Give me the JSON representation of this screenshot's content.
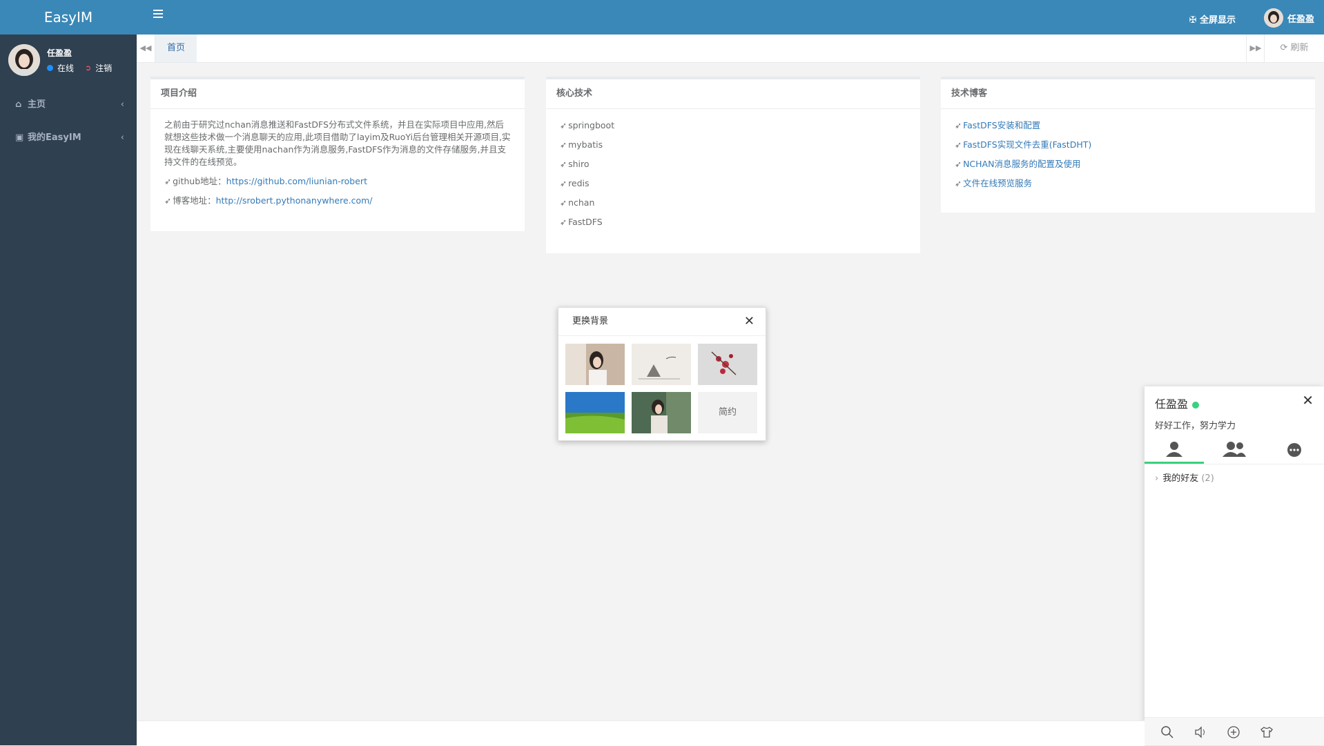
{
  "app": {
    "brand": "EasyIM"
  },
  "profile": {
    "name": "任盈盈",
    "status": "在线",
    "logout": "注销"
  },
  "sidebar": {
    "items": [
      {
        "label": "主页"
      },
      {
        "label": "我的EasyIM"
      }
    ]
  },
  "topbar": {
    "fullscreen": "全屏显示",
    "username": "任盈盈"
  },
  "tabs": {
    "home": "首页",
    "refresh": "刷新"
  },
  "intro": {
    "title": "项目介绍",
    "text": "之前由于研究过nchan消息推送和FastDFS分布式文件系统，并且在实际项目中应用,然后就想这些技术做一个消息聊天的应用,此项目借助了layim及RuoYi后台管理相关开源项目,实现在线聊天系统,主要使用nachan作为消息服务,FastDFS作为消息的文件存储服务,并且支持文件的在线预览。",
    "github_label": "github地址：",
    "github_url": "https://github.com/liunian-robert",
    "blog_label": "博客地址：",
    "blog_url": "http://srobert.pythonanywhere.com/"
  },
  "tech": {
    "title": "核心技术",
    "items": [
      "springboot",
      "mybatis",
      "shiro",
      "redis",
      "nchan",
      "FastDFS"
    ]
  },
  "blog": {
    "title": "技术博客",
    "items": [
      "FastDFS安装和配置",
      "FastDFS实现文件去重(FastDHT)",
      "NCHAN消息服务的配置及使用",
      "文件在线预览服务"
    ]
  },
  "bg_dialog": {
    "title": "更换背景",
    "simple_label": "简约"
  },
  "chat": {
    "name": "任盈盈",
    "sign": "好好工作，努力学力",
    "group_label": "我的好友",
    "group_count": "(2)"
  },
  "colors": {
    "primary": "#3a88b8",
    "sidebar": "#2f4050",
    "online": "#3ad17e",
    "link": "#337ab7"
  }
}
